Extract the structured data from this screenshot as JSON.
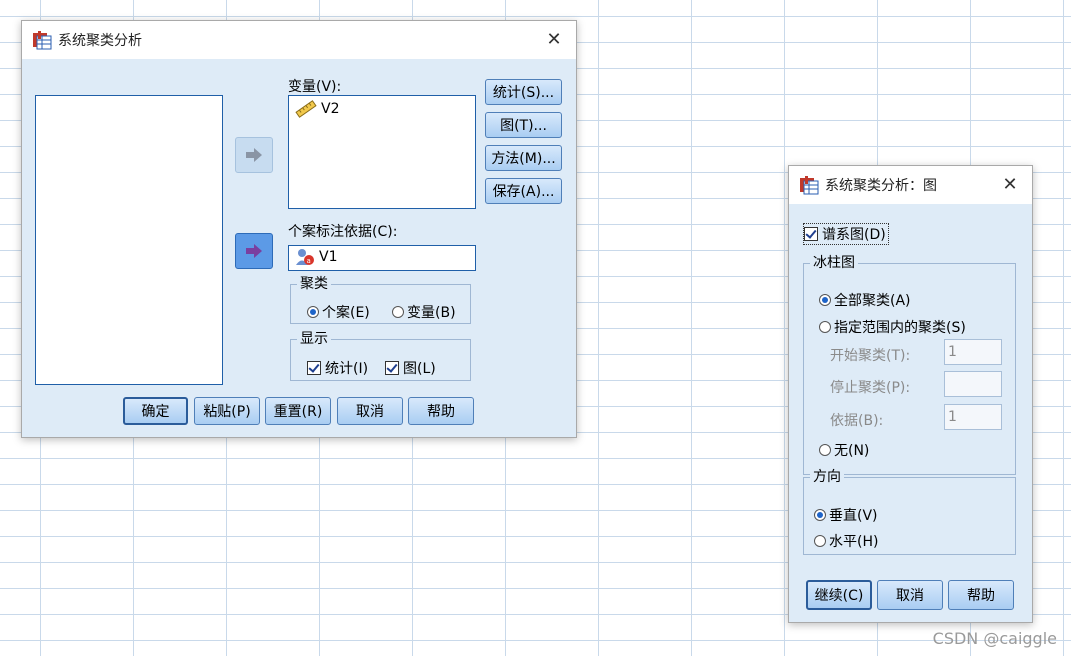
{
  "main_dialog": {
    "title": "系统聚类分析",
    "variables_label": "变量(V):",
    "variables": [
      "V2"
    ],
    "case_label_label": "个案标注依据(C):",
    "case_label_value": "V1",
    "side_buttons": [
      "统计(S)...",
      "图(T)...",
      "方法(M)...",
      "保存(A)..."
    ],
    "cluster_group": {
      "legend": "聚类",
      "option_cases": "个案(E)",
      "option_variables": "变量(B)"
    },
    "display_group": {
      "legend": "显示",
      "stats": "统计(I)",
      "plots": "图(L)"
    },
    "bottom_buttons": [
      "确定",
      "粘贴(P)",
      "重置(R)",
      "取消",
      "帮助"
    ]
  },
  "plot_dialog": {
    "title": "系统聚类分析：图",
    "dendrogram": "谱系图(D)",
    "icicle_group": {
      "legend": "冰柱图",
      "all_clusters": "全部聚类(A)",
      "range_clusters": "指定范围内的聚类(S)",
      "start_label": "开始聚类(T):",
      "start_value": "1",
      "stop_label": "停止聚类(P):",
      "stop_value": "",
      "by_label": "依据(B):",
      "by_value": "1",
      "none": "无(N)"
    },
    "orientation_group": {
      "legend": "方向",
      "vertical": "垂直(V)",
      "horizontal": "水平(H)"
    },
    "buttons": [
      "继续(C)",
      "取消",
      "帮助"
    ]
  },
  "watermark": "CSDN @caiggle"
}
